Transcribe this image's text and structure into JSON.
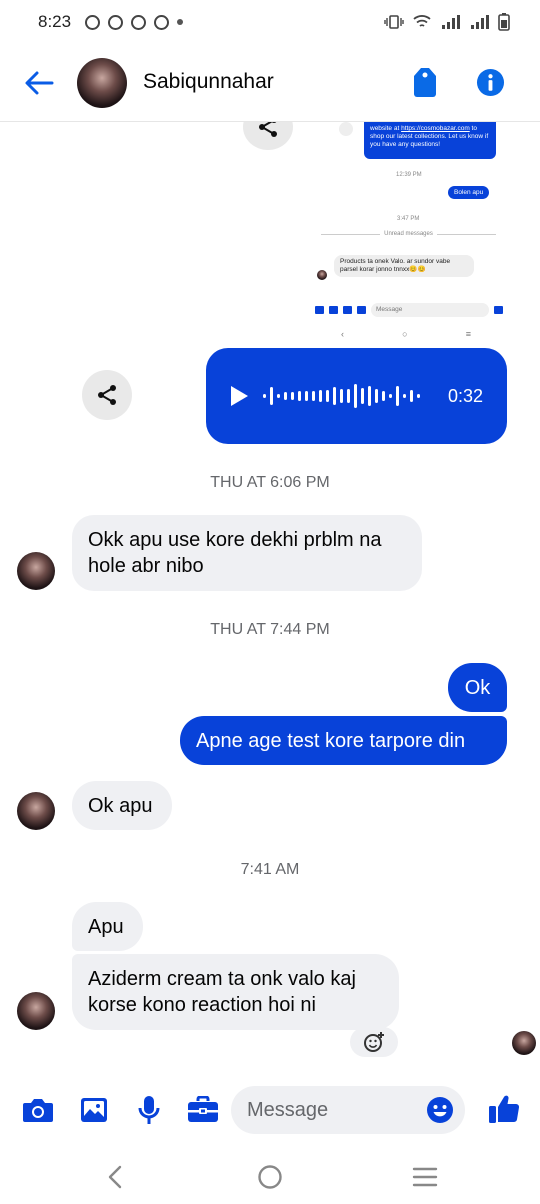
{
  "status_bar": {
    "time": "8:23"
  },
  "header": {
    "contact_name": "Sabiqunnahar"
  },
  "shared_image": {
    "bubble_prefix": "website at",
    "bubble_link": "https://cosmobazar.com",
    "bubble_suffix": "to shop our latest collections. Let us know if you have any questions!",
    "time1": "12:39 PM",
    "bolen": "Bolen apu",
    "time2": "3:47 PM",
    "unread": "Unread messages",
    "received": "Products ta onek Valo. ar sundor vabe parsel korar jonno tnnxx😊😊",
    "message_placeholder": "Message"
  },
  "voice_message": {
    "duration": "0:32"
  },
  "messages": {
    "ts1": "THU AT 6:06 PM",
    "recv1": "Okk apu use kore dekhi prblm na hole abr nibo",
    "ts2": "THU AT 7:44 PM",
    "sent1": "Ok",
    "sent2": "Apne age test kore tarpore din",
    "recv2": "Ok apu",
    "ts3": "7:41 AM",
    "recv3": "Apu",
    "recv4": "Aziderm cream ta onk valo kaj korse kono reaction hoi ni"
  },
  "composer": {
    "placeholder": "Message"
  },
  "colors": {
    "accent": "#0842d9",
    "received_bubble": "#eff0f3",
    "timestamp": "#65676b"
  }
}
